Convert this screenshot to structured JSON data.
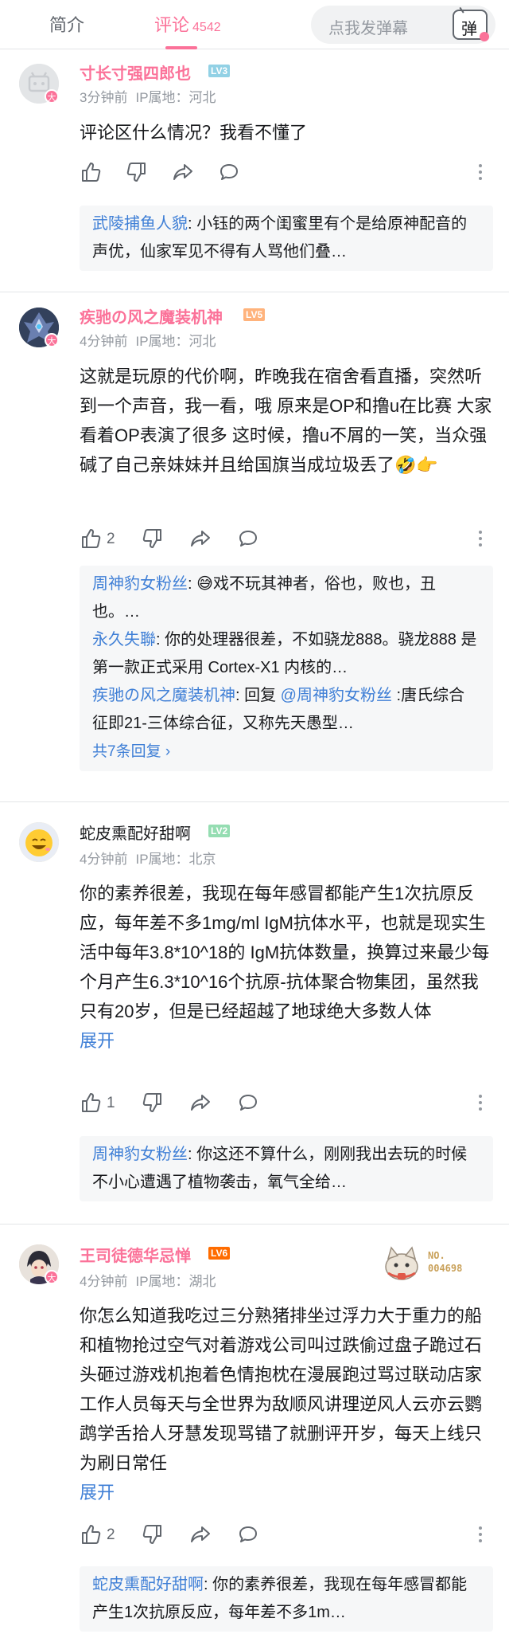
{
  "header": {
    "tab_intro": "简介",
    "tab_comments": "评论",
    "comment_count": "4542",
    "danmaku_placeholder": "点我发弹幕",
    "danmaku_button": "弹"
  },
  "comments": [
    {
      "username": "寸长寸强四郎也",
      "level": "LV3",
      "time": "3分钟前",
      "ip": "IP属地：河北",
      "text": "评论区什么情况？我看不懂了",
      "likes": "",
      "replies": [
        {
          "name": "武陵捕鱼人貌",
          "text": ": 小钰的两个闺蜜里有个是给原神配音的声优，仙家军见不得有人骂他们叠…"
        }
      ]
    },
    {
      "username": "疾驰の风之魔装机神",
      "level": "LV5",
      "time": "4分钟前",
      "ip": "IP属地：河北",
      "text": "这就是玩原的代价啊，昨晚我在宿舍看直播，突然听到一个声音，我一看，哦 原来是OP和撸u在比赛 大家看着OP表演了很多 这时候，撸u不屑的一笑，当众强碱了自己亲妹妹并且给国旗当成垃圾丢了🤣👉",
      "likes": "2",
      "replies": [
        {
          "name": "周神豹女粉丝",
          "text": ": 😅戏不玩其神者，俗也，败也，丑也。…"
        },
        {
          "name": "永久失聯",
          "text": ": 你的处理器很差，不如骁龙888。骁龙888 是第一款正式采用 Cortex-X1 内核的…"
        },
        {
          "name": "疾驰の风之魔装机神",
          "text_pre": ": 回复 ",
          "at": "@周神豹女粉丝",
          "text": " :唐氏综合征即21-三体综合征，又称先天愚型…"
        }
      ],
      "more_replies": "共7条回复 ›"
    },
    {
      "username": "蛇皮熏配好甜啊",
      "level": "LV2",
      "time": "4分钟前",
      "ip": "IP属地：北京",
      "text": "你的素养很差，我现在每年感冒都能产生1次抗原反应，每年差不多1mg/ml IgM抗体水平，也就是现实生活中每年3.8*10^18的 IgM抗体数量，换算过来最少每个月产生6.3*10^16个抗原-抗体聚合物集团，虽然我只有20岁，但是已经超越了地球绝大多数人体",
      "expand": "展开",
      "likes": "1",
      "replies": [
        {
          "name": "周神豹女粉丝",
          "text": ": 你这还不算什么，刚刚我出去玩的时候不小心遭遇了植物袭击，氧气全给…"
        }
      ]
    },
    {
      "username": "王司徒德华忌惮",
      "level": "LV6",
      "time": "4分钟前",
      "ip": "IP属地：湖北",
      "medal_no": "NO.",
      "medal_num": "004698",
      "text": "你怎么知道我吃过三分熟猪排坐过浮力大于重力的船和植物抢过空气对着游戏公司叫过跌偷过盘子跪过石头砸过游戏机抱着色情抱枕在漫展跑过骂过联动店家工作人员每天与全世界为敌顺风讲理逆风人云亦云鹦鹉学舌拾人牙慧发现骂错了就删评开岁，每天上线只为刷日常任",
      "expand": "展开",
      "likes": "2",
      "replies": [
        {
          "name": "蛇皮熏配好甜啊",
          "text": ": 你的素养很差，我现在每年感冒都能产生1次抗原反应，每年差不多1m…"
        }
      ]
    }
  ],
  "colors": {
    "accent": "#fb7299",
    "link": "#3f7fd6",
    "lv2": "#95ddb2",
    "lv3": "#92d1e5",
    "lv5": "#ffb37c",
    "lv6": "#ff6c00"
  }
}
